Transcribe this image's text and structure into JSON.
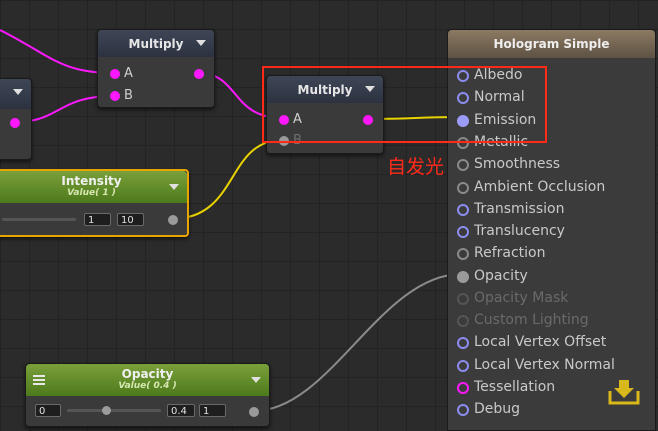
{
  "nodes": {
    "multiply_top": {
      "title": "Multiply",
      "ports": [
        "A",
        "B"
      ]
    },
    "multiply_mid": {
      "title": "Multiply",
      "ports": [
        "A",
        "B"
      ]
    },
    "intensity": {
      "title": "Intensity",
      "subtitle": "Value( 1 )",
      "field1": "1",
      "field2": "10"
    },
    "opacity": {
      "title": "Opacity",
      "subtitle": "Value( 0.4 )",
      "min": "0",
      "value": "0.4",
      "max": "1"
    }
  },
  "master": {
    "title": "Hologram Simple",
    "inputs": [
      "Albedo",
      "Normal",
      "Emission",
      "Metallic",
      "Smoothness",
      "Ambient Occlusion",
      "Transmission",
      "Translucency",
      "Refraction",
      "Opacity",
      "Opacity Mask",
      "Custom Lighting",
      "Local Vertex Offset",
      "Local Vertex Normal",
      "Tessellation",
      "Debug"
    ]
  },
  "annotation": {
    "text": "自发光",
    "color": "#ff2a1a"
  },
  "colors": {
    "wire_magenta": "#ff18ff",
    "wire_yellow": "#e8d200",
    "wire_gray": "#8a8a8a",
    "property_green": "#5f8a28"
  }
}
